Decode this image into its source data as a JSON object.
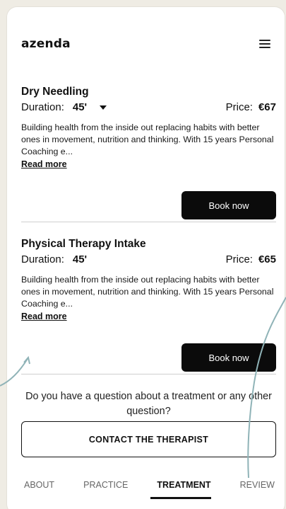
{
  "header": {
    "brand": "azenda"
  },
  "treatments": [
    {
      "title": "Dry Needling",
      "duration_label": "Duration:",
      "duration_value": "45'",
      "price_label": "Price:",
      "price_value": "€67",
      "description": "Building health from the inside out replacing habits with better ones in movement, nutrition and thinking. With 15 years Personal Coaching e...",
      "read_more": "Read more",
      "book": "Book now"
    },
    {
      "title": "Physical Therapy Intake",
      "duration_label": "Duration:",
      "duration_value": "45'",
      "price_label": "Price:",
      "price_value": "€65",
      "description": "Building health from the inside out replacing habits with better ones in movement, nutrition and thinking. With 15 years Personal Coaching e...",
      "read_more": "Read more",
      "book": "Book now"
    }
  ],
  "question": "Do you have a question about a treatment or any other question?",
  "contact_button": "CONTACT THE THERAPIST",
  "tabs": [
    {
      "label": "ABOUT"
    },
    {
      "label": "PRACTICE"
    },
    {
      "label": "TREATMENT"
    },
    {
      "label": "REVIEW"
    }
  ],
  "active_tab": "TREATMENT",
  "colors": {
    "page_bg": "#efece4",
    "button_bg": "#0b0b0b",
    "annotation_arrow": "#8fb3b7"
  }
}
